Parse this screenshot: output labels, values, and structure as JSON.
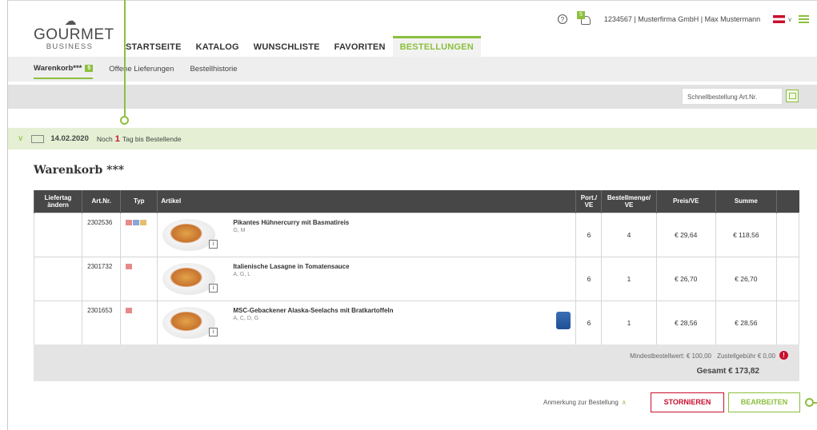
{
  "brand": {
    "line1": "GOURMET",
    "line2": "BUSINESS"
  },
  "nav": [
    "STARTSEITE",
    "KATALOG",
    "WUNSCHLISTE",
    "FAVORITEN",
    "BESTELLUNGEN"
  ],
  "utility": {
    "help": "?",
    "notif_count": "5",
    "account": "1234567 | Musterfirma GmbH | Max Mustermann"
  },
  "subnav": {
    "cart": "Warenkorb***",
    "cart_badge": "5",
    "open": "Offene Lieferungen",
    "history": "Bestellhistorie"
  },
  "quick": {
    "placeholder": "Schnellbestellung Art.Nr."
  },
  "delivery": {
    "date": "14.02.2020",
    "prefix": "Noch",
    "days": "1",
    "suffix": "Tag bis Bestellende"
  },
  "title": "Warenkorb ***",
  "table": {
    "headers": [
      "Liefertag ändern",
      "Art.Nr.",
      "Typ",
      "Artikel",
      "Port./ VE",
      "Bestellmenge/ VE",
      "Preis/VE",
      "Summe"
    ],
    "rows": [
      {
        "art": "2302536",
        "name": "Pikantes Hühnercurry mit Basmatireis",
        "allergens": "G, M",
        "port": "6",
        "qty": "4",
        "price": "€ 29,64",
        "sum": "€ 118,56"
      },
      {
        "art": "2301732",
        "name": "Italienische Lasagne in Tomatensauce",
        "allergens": "A, G, L",
        "port": "6",
        "qty": "1",
        "price": "€ 26,70",
        "sum": "€ 26,70"
      },
      {
        "art": "2301653",
        "name": "MSC-Gebackener Alaska-Seelachs mit Bratkartoffeln",
        "allergens": "A, C, D, G",
        "port": "6",
        "qty": "1",
        "price": "€ 28,56",
        "sum": "€ 28,56"
      }
    ]
  },
  "footer": {
    "min": "Mindestbestellwert: € 100,00",
    "fee": "Zustellgebühr € 0,00",
    "total": "Gesamt € 173,82"
  },
  "actions": {
    "note": "Anmerkung zur Bestellung",
    "cancel": "STORNIEREN",
    "edit": "BEARBEITEN"
  },
  "colors": {
    "accent": "#8cbf3e",
    "danger": "#c8102e",
    "header": "#474747"
  }
}
